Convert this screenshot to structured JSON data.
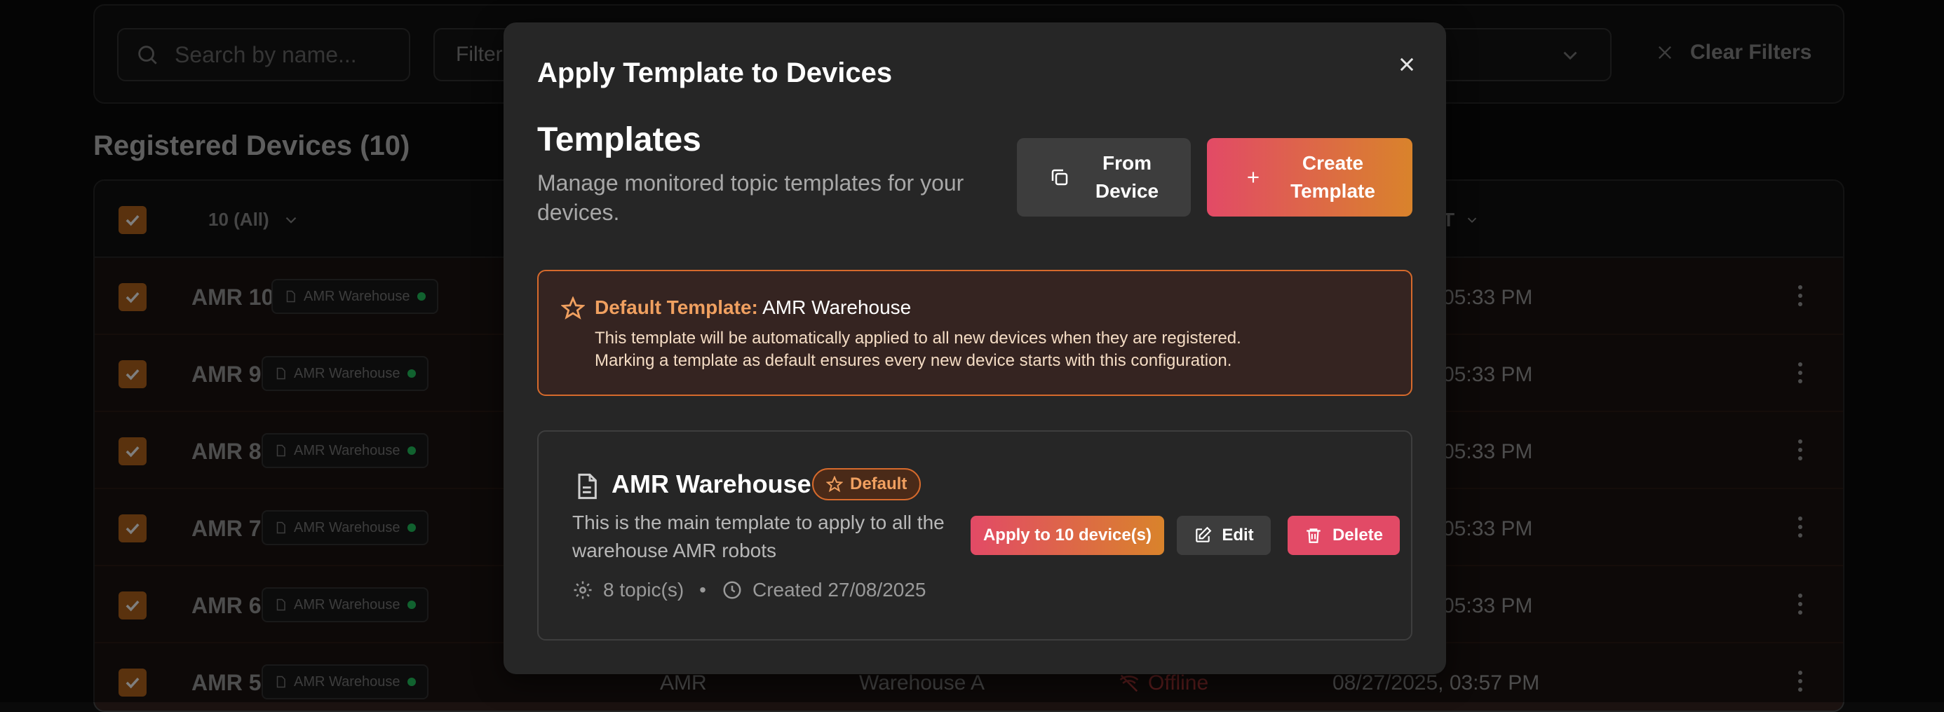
{
  "background": {
    "search_placeholder": "Search by name...",
    "filter_label": "Filter",
    "clear_filters": "Clear Filters",
    "section_title": "Registered Devices (10)",
    "select_all_label": "10 (All)",
    "column_last_seen": "T",
    "rows": [
      {
        "name": "AMR 10",
        "template": "AMR Warehouse",
        "time": "05:33 PM"
      },
      {
        "name": "AMR 9",
        "template": "AMR Warehouse",
        "time": "05:33 PM"
      },
      {
        "name": "AMR 8",
        "template": "AMR Warehouse",
        "time": "05:33 PM"
      },
      {
        "name": "AMR 7",
        "template": "AMR Warehouse",
        "time": "05:33 PM"
      },
      {
        "name": "AMR 6",
        "template": "AMR Warehouse",
        "time": "05:33 PM"
      },
      {
        "name": "AMR 5",
        "template": "AMR Warehouse",
        "type": "AMR",
        "location": "Warehouse A",
        "status": "Offline",
        "time": "08/27/2025, 03:57 PM"
      }
    ]
  },
  "modal": {
    "title": "Apply Template to Devices",
    "section_title": "Templates",
    "section_desc": "Manage monitored topic templates for your devices.",
    "from_device_label_1": "From",
    "from_device_label_2": "Device",
    "create_label_1": "Create",
    "create_label_2": "Template",
    "default_notice": {
      "label": "Default Template:",
      "value": "AMR Warehouse",
      "line1": "This template will be automatically applied to all new devices when they are registered.",
      "line2": "Marking a template as default ensures every new device starts with this configuration."
    },
    "template": {
      "name": "AMR Warehouse",
      "badge": "Default",
      "description": "This is the main template to apply to all the warehouse AMR robots",
      "topics": "8 topic(s)",
      "separator": "•",
      "created": "Created 27/08/2025",
      "apply_label": "Apply to 10 device(s)",
      "edit_label": "Edit",
      "delete_label": "Delete"
    }
  },
  "colors": {
    "accent_orange": "#d9832b",
    "accent_pink": "#e24a66",
    "modal_bg": "#262626"
  }
}
